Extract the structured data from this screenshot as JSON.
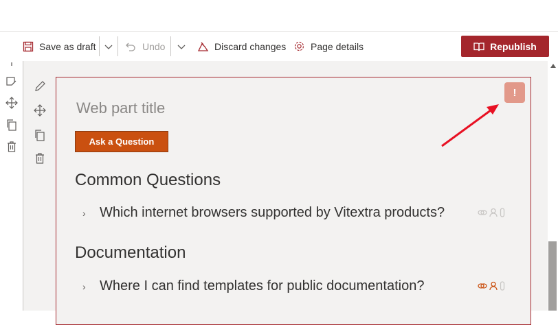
{
  "toolbar": {
    "save_draft": "Save as draft",
    "undo": "Undo",
    "discard": "Discard changes",
    "page_details": "Page details",
    "republish": "Republish"
  },
  "webpart": {
    "title_placeholder": "Web part title",
    "ask_button": "Ask a Question",
    "warning_symbol": "!",
    "sections": [
      {
        "heading": "Common Questions",
        "questions": [
          "Which internet browsers supported by Vitextra products?"
        ]
      },
      {
        "heading": "Documentation",
        "questions": [
          "Where I can find templates for public documentation?"
        ]
      }
    ]
  },
  "colors": {
    "accent": "#a4262c",
    "button": "#ca5010",
    "badge": "#e2998a",
    "arrow": "#e81123"
  }
}
